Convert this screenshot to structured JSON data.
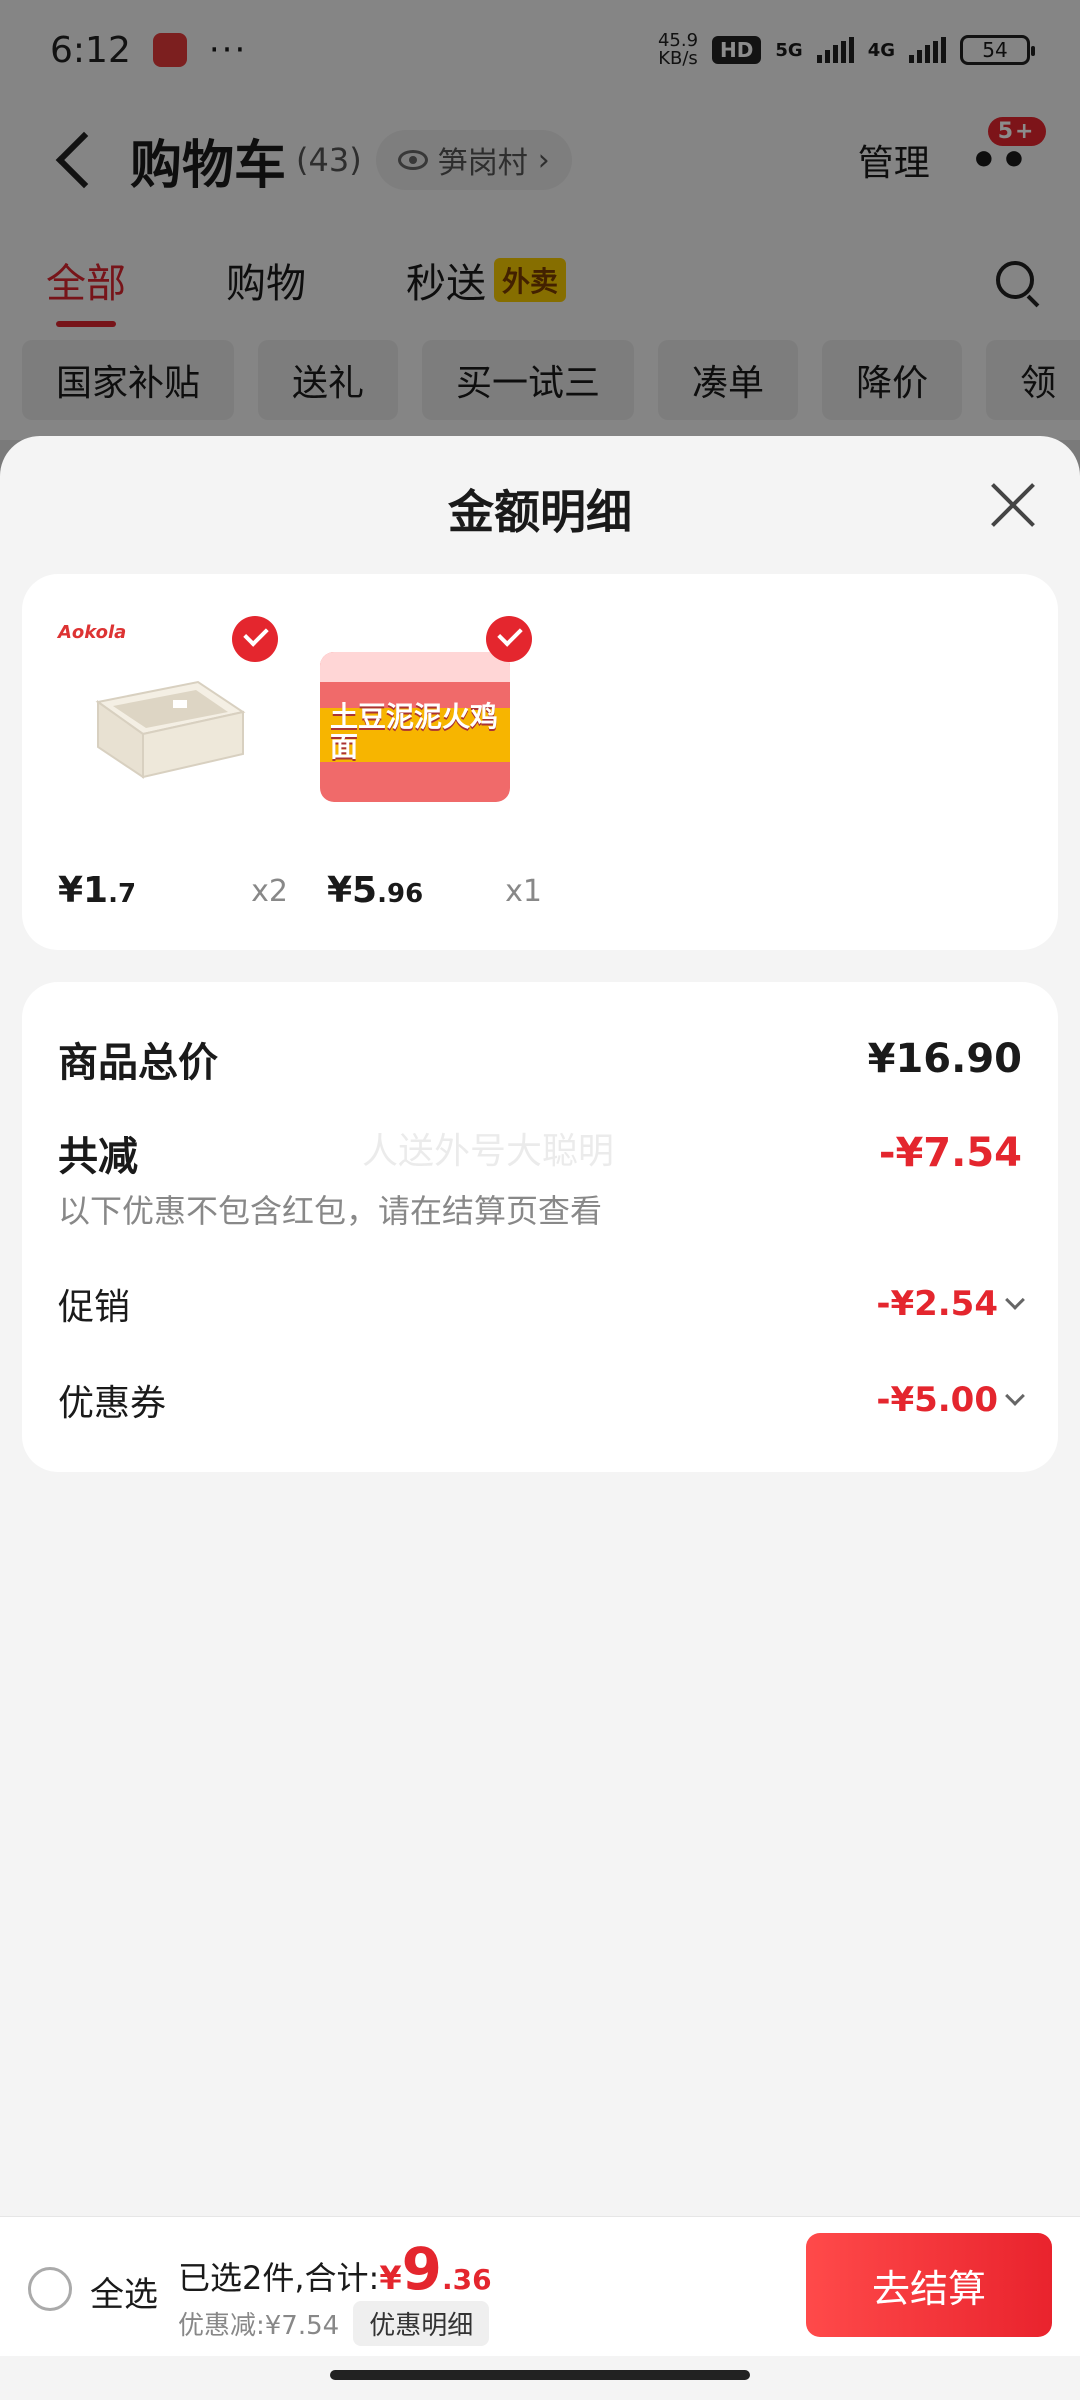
{
  "status_bar": {
    "time": "6:12",
    "dots": "···",
    "net_speed_value": "45.9",
    "net_speed_unit": "KB/s",
    "hd_label": "HD",
    "sig1_label": "5G",
    "sig2_label": "4G",
    "battery": "54"
  },
  "header": {
    "title": "购物车",
    "count": "(43)",
    "location": "笋岗村",
    "manage": "管理",
    "more_badge": "5+"
  },
  "tabs": {
    "all": "全部",
    "shopping": "购物",
    "express": "秒送",
    "takeout_badge": "外卖"
  },
  "chips": [
    "国家补贴",
    "送礼",
    "买一试三",
    "凑单",
    "降价",
    "领"
  ],
  "sheet": {
    "title": "金额明细",
    "products": [
      {
        "brand": "Aokola",
        "price_int": "¥1",
        "price_dec": ".7",
        "qty": "x2"
      },
      {
        "name": "土豆泥泥火鸡面",
        "price_int": "¥5",
        "price_dec": ".96",
        "qty": "x1"
      }
    ],
    "summary": {
      "total_label": "商品总价",
      "total_value": "¥16.90",
      "reduce_label": "共减",
      "reduce_value": "-¥7.54",
      "note": "以下优惠不包含红包，请在结算页查看",
      "promo_label": "促销",
      "promo_value": "-¥2.54",
      "coupon_label": "优惠券",
      "coupon_value": "-¥5.00",
      "watermark": "人送外号大聪明"
    }
  },
  "bottom_bar": {
    "select_all": "全选",
    "selected_text": "已选2件,合计:",
    "currency": "¥",
    "total_int": "9",
    "total_dec": ".36",
    "discount_text": "优惠减:¥7.54",
    "detail_chip": "优惠明细",
    "checkout": "去结算"
  },
  "colors": {
    "accent": "#e4262e",
    "takeout_badge": "#f5c800"
  }
}
